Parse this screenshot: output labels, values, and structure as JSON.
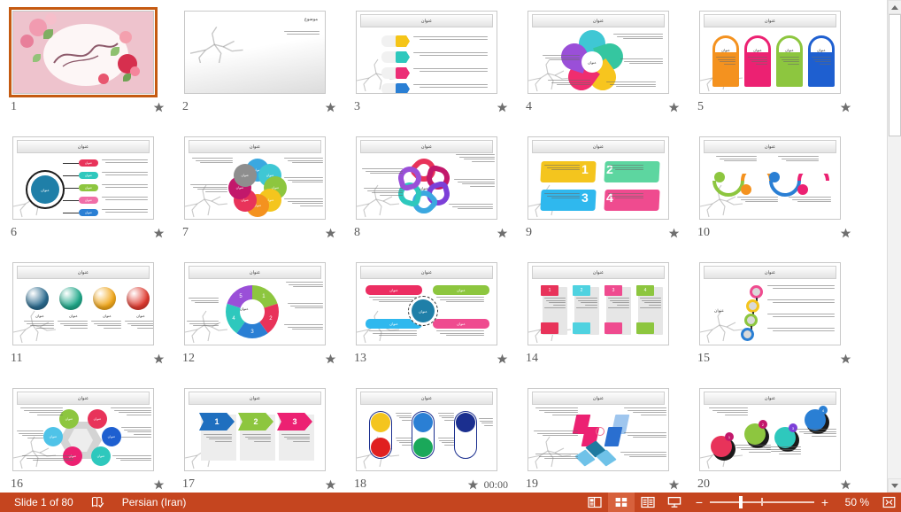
{
  "app": {
    "view": "slide-sorter",
    "accent_color": "#c5451f",
    "selection_color": "#c55a11"
  },
  "status_bar": {
    "slide_indicator": "Slide 1 of 80",
    "proofing_icon": "spell-check-icon",
    "language": "Persian (Iran)",
    "view_buttons": [
      {
        "name": "normal-view",
        "icon": "normal-view-icon",
        "active": false
      },
      {
        "name": "slide-sorter-view",
        "icon": "slide-sorter-icon",
        "active": true
      },
      {
        "name": "reading-view",
        "icon": "reading-view-icon",
        "active": false
      },
      {
        "name": "slide-show-view",
        "icon": "slide-show-icon",
        "active": false
      }
    ],
    "zoom_out_label": "−",
    "zoom_in_label": "+",
    "zoom_level": "50 %",
    "fit_button_icon": "fit-to-window-icon"
  },
  "scrollbar": {
    "up_icon": "scroll-up-arrow-icon",
    "down_icon": "scroll-down-arrow-icon",
    "thumb_name": "vertical-scroll-thumb"
  },
  "labels": {
    "slide_title_placeholder": "عنوان",
    "topic_label": "موضوع",
    "transition_star": "transition-star-icon"
  },
  "slides": [
    {
      "number": "1",
      "layout": "cover-floral",
      "selected": true,
      "star": true,
      "timing": ""
    },
    {
      "number": "2",
      "layout": "cracked-ground-topic",
      "selected": false,
      "star": true,
      "timing": ""
    },
    {
      "number": "3",
      "layout": "four-numbered-pills",
      "selected": false,
      "star": true,
      "timing": "",
      "colors": [
        "#f5c518",
        "#2ec8bd",
        "#ec2e76",
        "#2a7fd4"
      ]
    },
    {
      "number": "4",
      "layout": "five-petal-flower",
      "selected": false,
      "star": true,
      "timing": "",
      "colors": [
        "#3fc7d4",
        "#35c6a0",
        "#f7c51e",
        "#ef2d6f",
        "#9a4fd8",
        "#3ba8e0"
      ]
    },
    {
      "number": "5",
      "layout": "four-tablets",
      "selected": false,
      "star": true,
      "timing": "",
      "colors": [
        "#f4921f",
        "#ec2172",
        "#8dc63f",
        "#1e5fd0"
      ]
    },
    {
      "number": "6",
      "layout": "hub-and-branches",
      "selected": false,
      "star": true,
      "timing": "",
      "colors": [
        "#e8335a",
        "#2ec8bd",
        "#8dc63f",
        "#f06fa8",
        "#2a7fd4"
      ]
    },
    {
      "number": "7",
      "layout": "eight-petal-wheel",
      "selected": false,
      "star": true,
      "timing": "",
      "colors": [
        "#3ba8e0",
        "#3fc7d4",
        "#8dc63f",
        "#f4c51e",
        "#f4921f",
        "#e8335a",
        "#c2186b",
        "#8e8e8e"
      ]
    },
    {
      "number": "8",
      "layout": "ribbon-loops",
      "selected": false,
      "star": true,
      "timing": "",
      "colors": [
        "#e8335a",
        "#c2186b",
        "#7c3fd8",
        "#3ba8e0",
        "#2ec8bd",
        "#9a4fd8"
      ]
    },
    {
      "number": "9",
      "layout": "four-callout-boxes",
      "selected": false,
      "star": true,
      "timing": "",
      "colors": [
        "#f4c51e",
        "#5dd6a0",
        "#2fb8ee",
        "#ef4b8f"
      ]
    },
    {
      "number": "10",
      "layout": "wave-timeline",
      "selected": false,
      "star": true,
      "timing": "",
      "colors": [
        "#8dc63f",
        "#f4921f",
        "#2a7fd4",
        "#ec2172"
      ]
    },
    {
      "number": "11",
      "layout": "four-spheres",
      "selected": false,
      "star": true,
      "timing": "",
      "colors": [
        "#2b6b8f",
        "#20a98a",
        "#f2a81c",
        "#e03c31"
      ]
    },
    {
      "number": "12",
      "layout": "five-segment-spiral",
      "selected": false,
      "star": true,
      "timing": "",
      "colors": [
        "#8dc63f",
        "#e8335a",
        "#2a7fd4",
        "#2ec8bd",
        "#9a4fd8"
      ]
    },
    {
      "number": "13",
      "layout": "four-quadrant-bars",
      "selected": false,
      "star": true,
      "timing": "",
      "colors": [
        "#ec2e62",
        "#8dc63f",
        "#2fb8ee",
        "#ef4b8f"
      ]
    },
    {
      "number": "14",
      "layout": "four-numbered-cards",
      "selected": false,
      "star": false,
      "timing": "",
      "colors": [
        "#e8335a",
        "#4fd2e0",
        "#ef4b8f",
        "#8dc63f"
      ]
    },
    {
      "number": "15",
      "layout": "vertical-ring-chain",
      "selected": false,
      "star": true,
      "timing": "",
      "colors": [
        "#ef4b8f",
        "#f4c51e",
        "#8dc63f",
        "#2a7fd4"
      ]
    },
    {
      "number": "16",
      "layout": "hexagon-hub",
      "selected": false,
      "star": true,
      "timing": "",
      "colors": [
        "#8dc63f",
        "#e8335a",
        "#4fc3e8",
        "#1e5fd0",
        "#ec2172",
        "#2ec8bd"
      ]
    },
    {
      "number": "17",
      "layout": "three-arrow-banners",
      "selected": false,
      "star": true,
      "timing": "",
      "colors": [
        "#1f6fbf",
        "#8dc63f",
        "#ec2172"
      ]
    },
    {
      "number": "18",
      "layout": "stadium-circles",
      "selected": false,
      "star": true,
      "timing": "00:00",
      "colors": [
        "#f4c51e",
        "#e02020",
        "#2a7fd4",
        "#1aa85a",
        "#1b2f8f"
      ]
    },
    {
      "number": "19",
      "layout": "diamond-cluster",
      "selected": false,
      "star": true,
      "timing": "",
      "colors": [
        "#ec2172",
        "#9fc6ee",
        "#2a6fd0",
        "#1f7aa0",
        "#6fc2e8"
      ]
    },
    {
      "number": "20",
      "layout": "balloon-circles",
      "selected": false,
      "star": true,
      "timing": "",
      "colors": [
        "#e8335a",
        "#8dc63f",
        "#2ec8bd",
        "#2a7fd4",
        "#c2186b",
        "#7c3fd8"
      ]
    }
  ]
}
